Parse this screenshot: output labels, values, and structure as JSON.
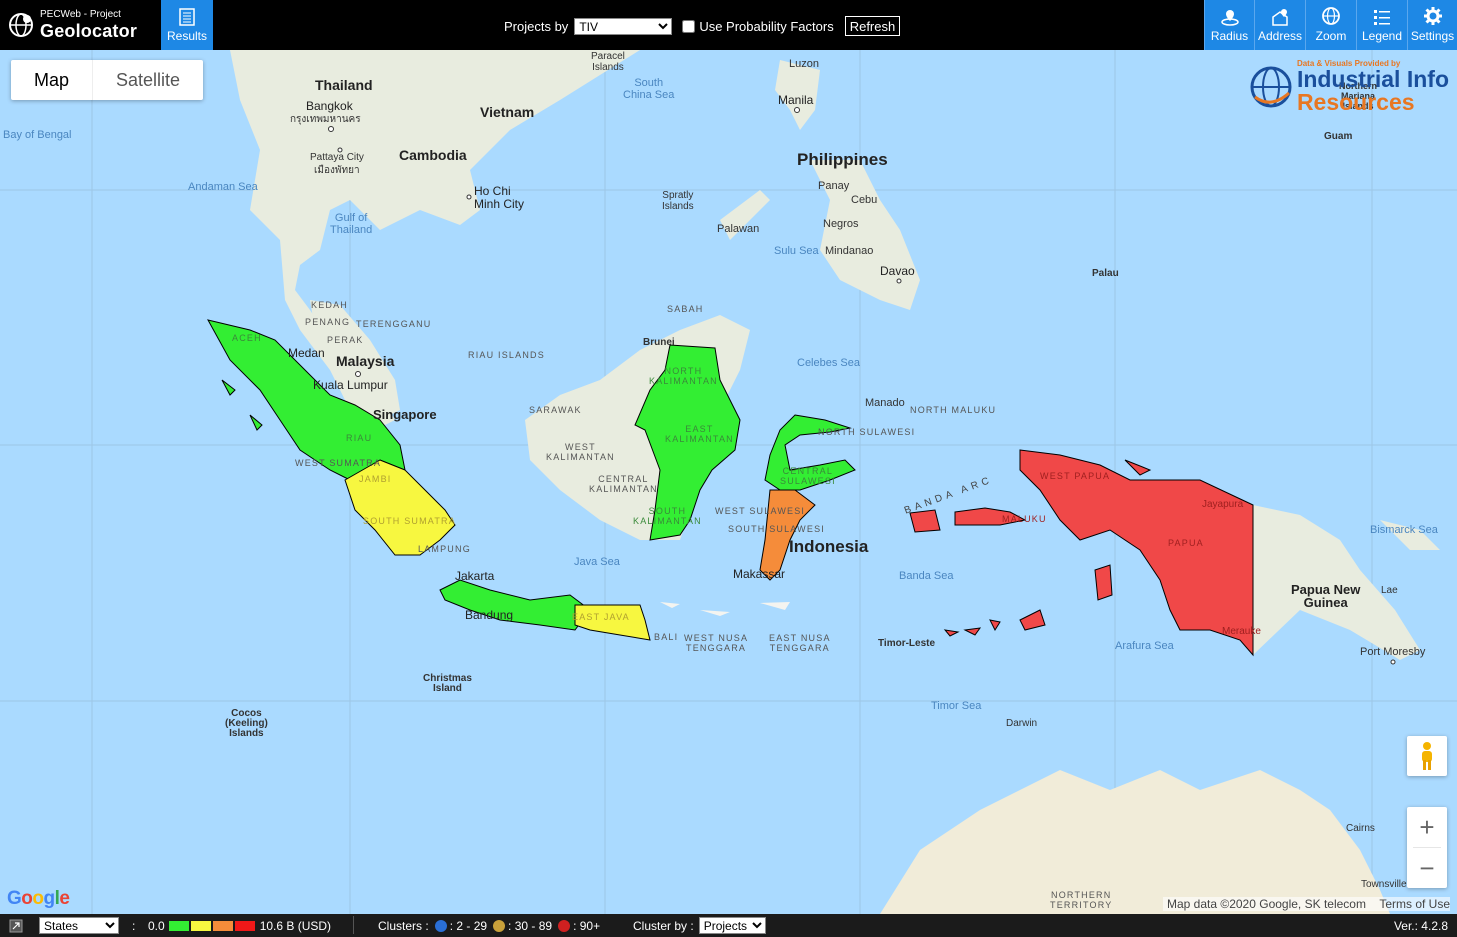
{
  "app": {
    "logo_small": "PECWeb - Project",
    "logo_big": "Geolocator",
    "results_label": "Results"
  },
  "toolbar": {
    "projects_by_label": "Projects by",
    "projects_by_value": "TIV",
    "use_probability_label": "Use Probability Factors",
    "refresh_label": "Refresh",
    "right_buttons": [
      {
        "label": "Radius",
        "icon": "radius-icon"
      },
      {
        "label": "Address",
        "icon": "address-icon"
      },
      {
        "label": "Zoom",
        "icon": "zoom-globe-icon"
      },
      {
        "label": "Legend",
        "icon": "legend-list-icon"
      },
      {
        "label": "Settings",
        "icon": "gear-icon"
      }
    ]
  },
  "map": {
    "map_tab": "Map",
    "satellite_tab": "Satellite",
    "iir_tagline": "Data & Visuals Provided by",
    "iir_line1": "Industrial Info",
    "iir_line2": "Resources",
    "attribution": "Map data ©2020 Google, SK telecom",
    "terms": "Terms of Use",
    "google": "Google",
    "zoom_in": "+",
    "zoom_out": "−",
    "region_colors": {
      "low": "#33ee33",
      "mid_low": "#f7f740",
      "mid_high": "#f58c3a",
      "high": "#f04848"
    },
    "labels": {
      "thailand": "Thailand",
      "bangkok": "Bangkok",
      "bangkok_th": "กรุงเทพมหานคร",
      "pattaya": "Pattaya City",
      "pattaya_th": "เมืองพัทยา",
      "cambodia": "Cambodia",
      "vietnam": "Vietnam",
      "hcmc": "Ho Chi\nMinh City",
      "bay_bengal": "Bay of Bengal",
      "andaman": "Andaman Sea",
      "gulf_thailand": "Gulf of\nThailand",
      "paracel": "Paracel\nIslands",
      "south_china_sea": "South\nChina Sea",
      "spratly": "Spratly\nIslands",
      "luzon": "Luzon",
      "manila": "Manila",
      "philippines": "Philippines",
      "panay": "Panay",
      "cebu": "Cebu",
      "negros": "Negros",
      "palawan": "Palawan",
      "sulu": "Sulu Sea",
      "mindanao": "Mindanao",
      "davao": "Davao",
      "palau": "Palau",
      "guam": "Guam",
      "n_mariana": "Northern\nMariana\nIslands",
      "kedah": "KEDAH",
      "penang": "PENANG",
      "terengganu": "TERENGGANU",
      "perak": "PERAK",
      "malaysia": "Malaysia",
      "medan": "Medan",
      "kuala_lumpur": "Kuala Lumpur",
      "singapore": "Singapore",
      "riau_islands": "RIAU ISLANDS",
      "sabah": "SABAH",
      "brunei": "Brunei",
      "sarawak": "SARAWAK",
      "celebes": "Celebes Sea",
      "manado": "Manado",
      "north_maluku": "NORTH MALUKU",
      "north_sulawesi": "NORTH SULAWESI",
      "aceh": "ACEH",
      "riau": "RIAU",
      "west_sumatra": "WEST SUMATRA",
      "jambi": "JAMBI",
      "south_sumatra": "SOUTH SUMATRA",
      "lampung": "LAMPUNG",
      "west_kalimantan": "WEST\nKALIMANTAN",
      "central_kalimantan": "CENTRAL\nKALIMANTAN",
      "north_kalimantan": "NORTH\nKALIMANTAN",
      "east_kalimantan": "EAST\nKALIMANTAN",
      "south_kalimantan": "SOUTH\nKALIMANTAN",
      "west_sulawesi": "WEST SULAWESI",
      "south_sulawesi": "SOUTH SULAWESI",
      "central_sulawesi": "CENTRAL\nSULAWESI",
      "indonesia": "Indonesia",
      "makassar": "Makassar",
      "java_sea": "Java Sea",
      "jakarta": "Jakarta",
      "bandung": "Bandung",
      "east_java": "EAST JAVA",
      "bali": "BALI",
      "west_nusa": "WEST NUSA\nTENGGARA",
      "east_nusa": "EAST NUSA\nTENGGARA",
      "banda_arc": "BANDA ARC",
      "banda_sea": "Banda Sea",
      "west_papua": "WEST PAPUA",
      "maluku": "MALUKU",
      "papua": "PAPUA",
      "jayapura": "Jayapura",
      "merauke": "Merauke",
      "png": "Papua New\nGuinea",
      "lae": "Lae",
      "bismarck": "Bismarck Sea",
      "port_moresby": "Port Moresby",
      "timor_leste": "Timor-Leste",
      "arafura": "Arafura Sea",
      "timor_sea": "Timor Sea",
      "darwin": "Darwin",
      "northern_territory": "NORTHERN\nTERRITORY",
      "cairns": "Cairns",
      "townsville": "Townsville",
      "christmas": "Christmas\nIsland",
      "cocos": "Cocos\n(Keeling)\nIslands"
    }
  },
  "bottombar": {
    "region_select": "States",
    "colon": ":",
    "scale_min": "0.0",
    "scale_max": "10.6 B (USD)",
    "clusters_label": "Clusters :",
    "cluster_1": ": 2 - 29",
    "cluster_2": ": 30 - 89",
    "cluster_3": ": 90+",
    "cluster_by_label": "Cluster by :",
    "cluster_by_value": "Projects",
    "version": "Ver.: 4.2.8",
    "scale_colors": [
      "#33ee33",
      "#f7f740",
      "#f58c3a",
      "#f01818"
    ],
    "cluster_colors": [
      "#2a6fd6",
      "#c9a13a",
      "#d02020"
    ]
  }
}
